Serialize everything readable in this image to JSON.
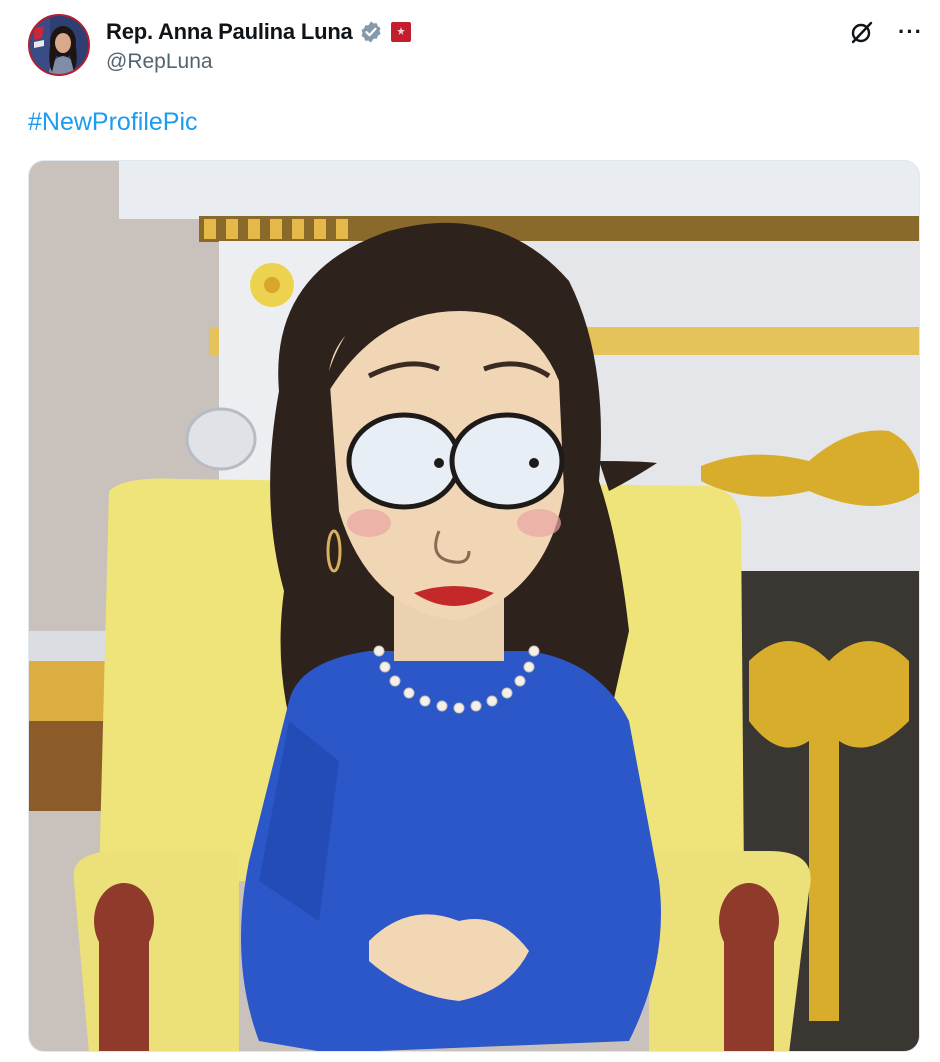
{
  "author": {
    "display_name": "Rep. Anna Paulina Luna",
    "handle": "@RepLuna",
    "verified": true,
    "verified_badge_color": "#829aab",
    "affiliation_badge_color": "#c41d2d"
  },
  "post": {
    "hashtag": "#NewProfilePic",
    "hashtag_color": "#1d9bf0"
  },
  "icons": {
    "grok": "grok-icon",
    "more": "more-options-icon",
    "verified": "verified-badge-icon",
    "affiliation": "government-affiliation-icon"
  },
  "media": {
    "kind": "cartoon-illustration",
    "dominant_colors": {
      "dress": "#2b57c9",
      "chair": "#efe47a",
      "hair": "#2e221d",
      "lips": "#c42828",
      "gold_ornament": "#d8ad2c"
    }
  }
}
